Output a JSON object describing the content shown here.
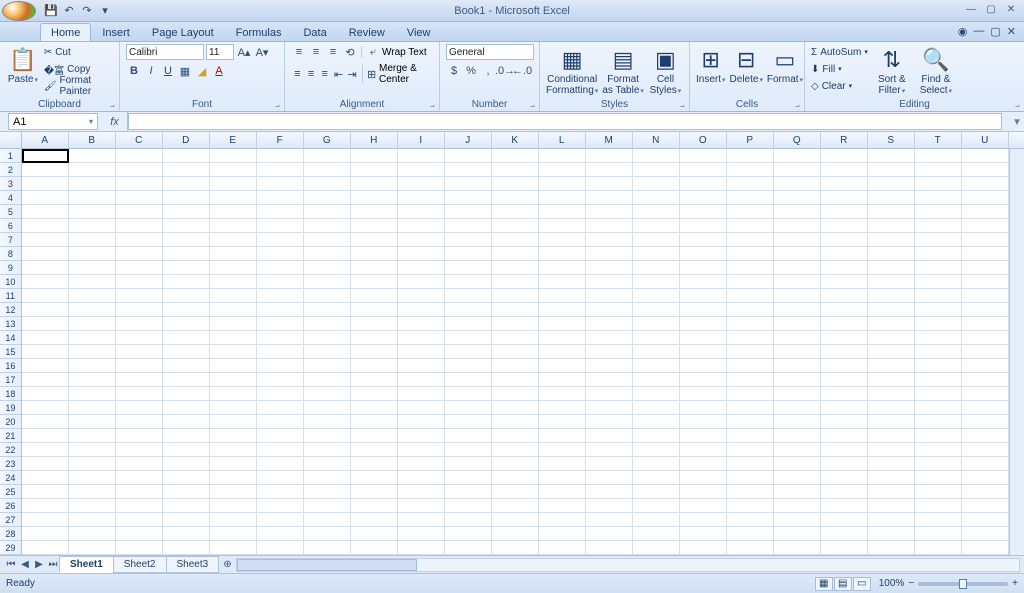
{
  "app": {
    "title": "Book1 - Microsoft Excel"
  },
  "qat": {
    "save": "💾",
    "undo": "↶",
    "redo": "↷"
  },
  "tabs": [
    "Home",
    "Insert",
    "Page Layout",
    "Formulas",
    "Data",
    "Review",
    "View"
  ],
  "active_tab": "Home",
  "ribbon": {
    "clipboard": {
      "label": "Clipboard",
      "paste": "Paste",
      "cut": "Cut",
      "copy": "Copy",
      "format_painter": "Format Painter"
    },
    "font": {
      "label": "Font",
      "name": "Calibri",
      "size": "11"
    },
    "alignment": {
      "label": "Alignment",
      "wrap": "Wrap Text",
      "merge": "Merge & Center"
    },
    "number": {
      "label": "Number",
      "format": "General"
    },
    "styles": {
      "label": "Styles",
      "conditional": "Conditional Formatting",
      "table": "Format as Table",
      "cell": "Cell Styles"
    },
    "cells": {
      "label": "Cells",
      "insert": "Insert",
      "delete": "Delete",
      "format": "Format"
    },
    "editing": {
      "label": "Editing",
      "autosum": "AutoSum",
      "fill": "Fill",
      "clear": "Clear",
      "sort": "Sort & Filter",
      "find": "Find & Select"
    }
  },
  "namebox": "A1",
  "columns": [
    "A",
    "B",
    "C",
    "D",
    "E",
    "F",
    "G",
    "H",
    "I",
    "J",
    "K",
    "L",
    "M",
    "N",
    "O",
    "P",
    "Q",
    "R",
    "S",
    "T",
    "U"
  ],
  "rows": 29,
  "sheets": [
    "Sheet1",
    "Sheet2",
    "Sheet3"
  ],
  "active_sheet": "Sheet1",
  "status": {
    "ready": "Ready",
    "zoom": "100%"
  }
}
